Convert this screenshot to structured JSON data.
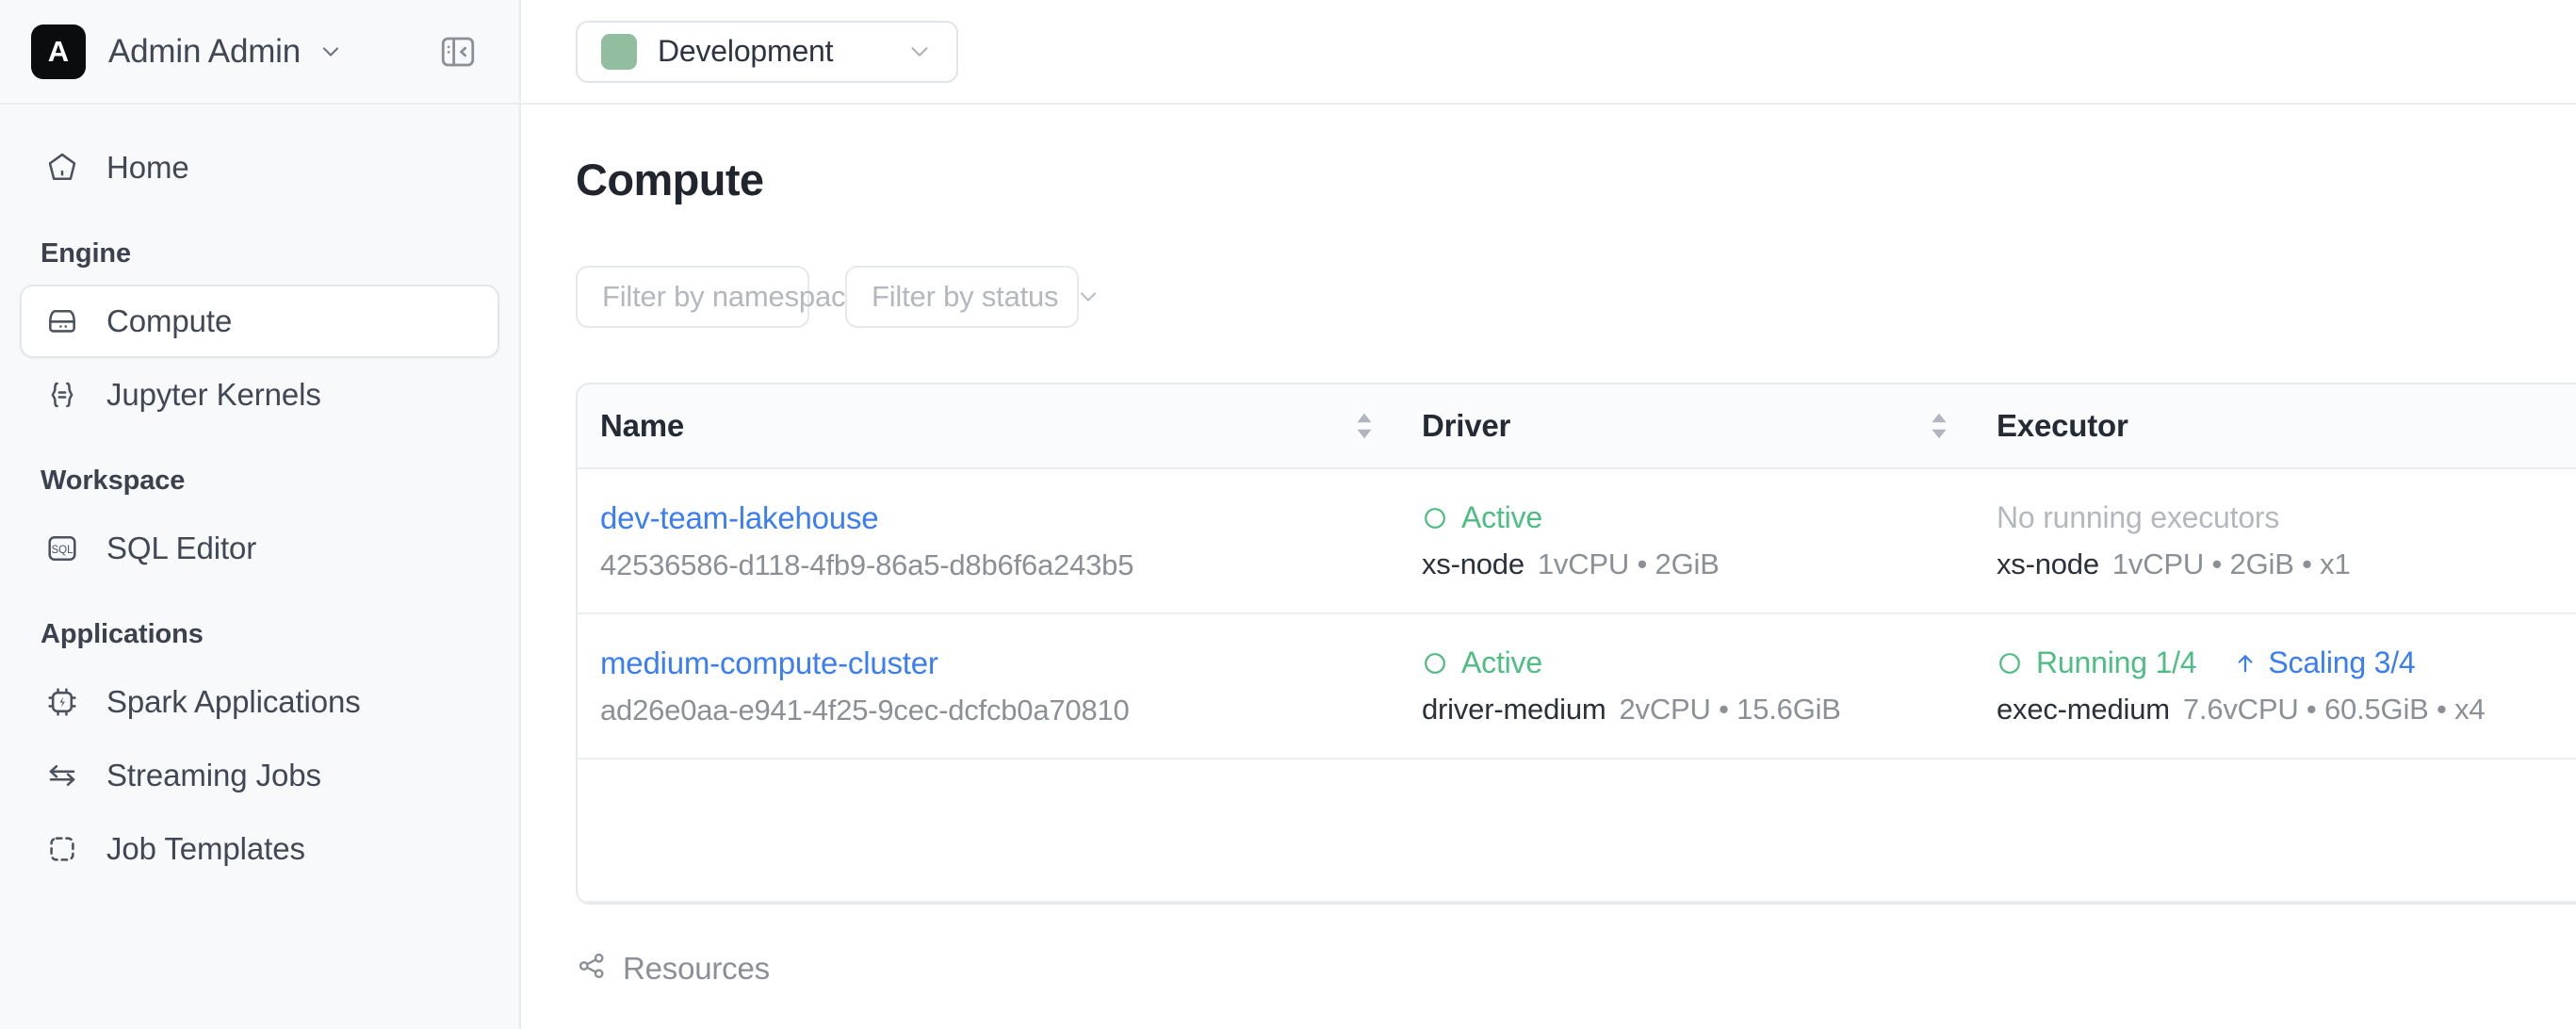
{
  "sidebar": {
    "user": {
      "initial": "A",
      "name": "Admin Admin"
    },
    "panel_toggle_name": "collapse-sidebar",
    "nav": [
      {
        "type": "item",
        "label": "Home",
        "icon": "home-icon",
        "active": false
      },
      {
        "type": "section",
        "label": "Engine"
      },
      {
        "type": "item",
        "label": "Compute",
        "icon": "compute-icon",
        "active": true
      },
      {
        "type": "item",
        "label": "Jupyter Kernels",
        "icon": "jupyter-kernel-icon",
        "active": false
      },
      {
        "type": "section",
        "label": "Workspace"
      },
      {
        "type": "item",
        "label": "SQL Editor",
        "icon": "sql-icon",
        "active": false
      },
      {
        "type": "section",
        "label": "Applications"
      },
      {
        "type": "item",
        "label": "Spark Applications",
        "icon": "spark-chip-icon",
        "active": false
      },
      {
        "type": "item",
        "label": "Streaming Jobs",
        "icon": "streaming-arrows-icon",
        "active": false
      },
      {
        "type": "item",
        "label": "Job Templates",
        "icon": "dashed-square-icon",
        "active": false
      }
    ]
  },
  "topbar": {
    "environment": {
      "label": "Development",
      "color": "#92bd9e"
    }
  },
  "page": {
    "title": "Compute",
    "filters": [
      {
        "placeholder": "Filter by namespace",
        "name": "filter-namespace"
      },
      {
        "placeholder": "Filter by status",
        "name": "filter-status"
      }
    ],
    "table": {
      "columns": [
        {
          "label": "Name",
          "sortable": true
        },
        {
          "label": "Driver",
          "sortable": true
        },
        {
          "label": "Executor",
          "sortable": false
        }
      ],
      "rows": [
        {
          "name": "dev-team-lakehouse",
          "id": "42536586-d118-4fb9-86a5-d8b6f6a243b5",
          "driver": {
            "status": "Active",
            "status_type": "active",
            "node": "xs-node",
            "spec": "1vCPU • 2GiB"
          },
          "executor": {
            "status": "No running executors",
            "status_type": "none",
            "scaling": null,
            "node": "xs-node",
            "spec": "1vCPU • 2GiB • x1"
          }
        },
        {
          "name": "medium-compute-cluster",
          "id": "ad26e0aa-e941-4f25-9cec-dcfcb0a70810",
          "driver": {
            "status": "Active",
            "status_type": "active",
            "node": "driver-medium",
            "spec": "2vCPU • 15.6GiB"
          },
          "executor": {
            "status": "Running 1/4",
            "status_type": "running",
            "scaling": "Scaling 3/4",
            "node": "exec-medium",
            "spec": "7.6vCPU • 60.5GiB • x4"
          }
        }
      ]
    },
    "resources": {
      "label": "Resources",
      "icon": "share-nodes-icon"
    }
  },
  "colors": {
    "link": "#3b7df5",
    "success": "#4fbc83",
    "muted": "#8b9096",
    "env_swatch": "#92bd9e"
  }
}
